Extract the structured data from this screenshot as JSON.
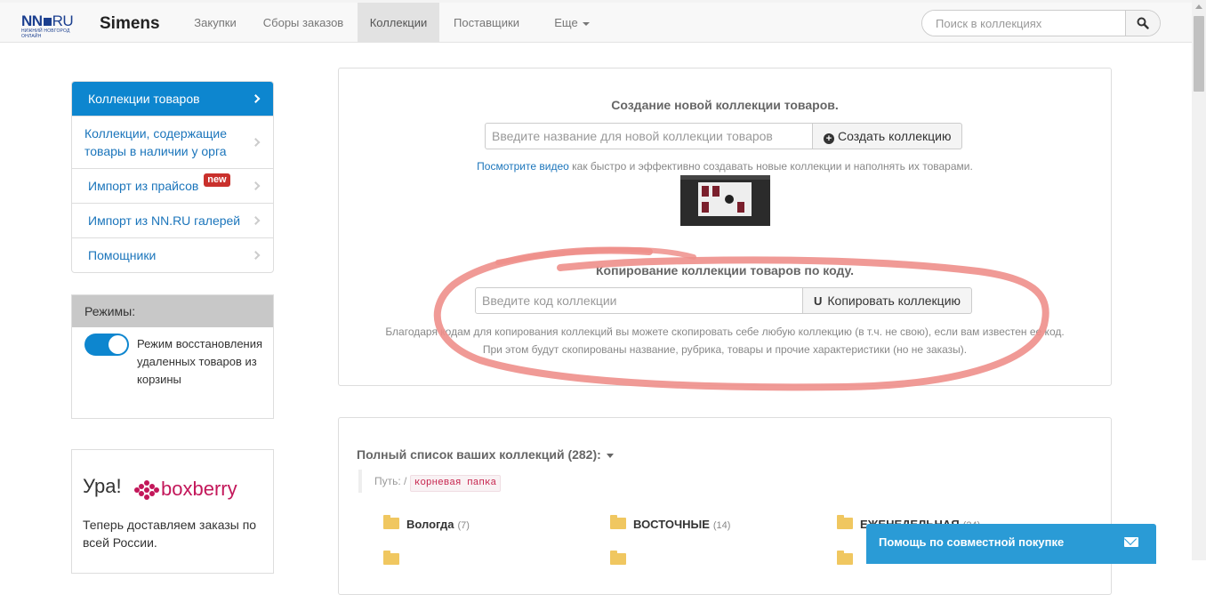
{
  "header": {
    "logo_main": "NN",
    "logo_ru": "RU",
    "logo_sub": "нижний новгород онлайн",
    "brand": "Simens",
    "nav": [
      {
        "label": "Закупки"
      },
      {
        "label": "Сборы заказов"
      },
      {
        "label": "Коллекции",
        "active": true
      },
      {
        "label": "Поставщики"
      },
      {
        "label": "Еще"
      }
    ],
    "search_placeholder": "Поиск в коллекциях",
    "search_icon": "search-icon"
  },
  "sidebar": {
    "items": [
      {
        "label": "Коллекции товаров",
        "active": true
      },
      {
        "label": "Коллекции, содержащие товары в наличии у орга"
      },
      {
        "label": "Импорт из прайсов",
        "badge": "new"
      },
      {
        "label": "Импорт из NN.RU галерей"
      },
      {
        "label": "Помощники"
      }
    ],
    "modes_title": "Режимы:",
    "mode_toggle": {
      "on": true,
      "label": "Режим восстановления удаленных товаров из корзины"
    },
    "promo": {
      "title": "Ура!",
      "logo": "boxberry",
      "text": "Теперь доставляем заказы по всей России."
    }
  },
  "create": {
    "title": "Создание новой коллекции товаров.",
    "placeholder": "Введите название для новой коллекции товаров",
    "button": "Создать коллекцию",
    "video_link": "Посмотрите видео",
    "video_hint": " как быстро и эффективно создавать новые коллекции и наполнять их товарами."
  },
  "copy": {
    "title": "Копирование коллекции товаров по коду.",
    "placeholder": "Введите код коллекции",
    "button": "Копировать коллекцию",
    "hint1": "Благодаря кодам для копирования коллекций вы можете скопировать себе любую коллекцию (в т.ч. не свою), если вам известен ее код.",
    "hint2": "При этом будут скопированы название, рубрика, товары и прочие характеристики (но не заказы)."
  },
  "collections": {
    "title": "Полный список ваших коллекций (282):",
    "path_label": "Путь: /",
    "path_code": "корневая папка",
    "folders": [
      {
        "name": "Вологда",
        "count": "(7)"
      },
      {
        "name": "ВОСТОЧНЫЕ",
        "count": "(14)"
      },
      {
        "name": "ЕЖЕНЕДЕЛЬНАЯ",
        "count": "(24)"
      }
    ]
  },
  "help": {
    "label": "Помощь по совместной покупке",
    "icon": "envelope-icon"
  },
  "colors": {
    "accent": "#0d86cf",
    "link": "#1b75bb",
    "help_bg": "#2a9bd6",
    "badge": "#c9302c",
    "annotation": "#ee8f8b",
    "folder": "#f0c760"
  }
}
